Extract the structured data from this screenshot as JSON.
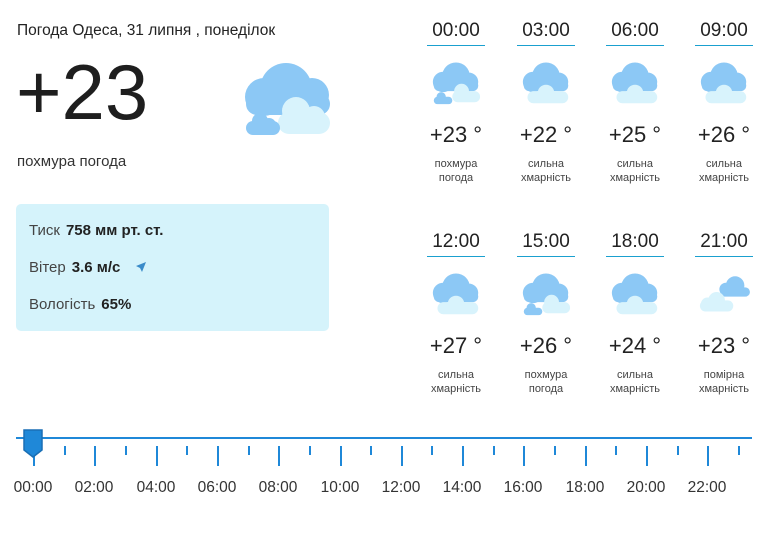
{
  "header": {
    "title": "Погода Одеса, 31 липня , понеділок",
    "temperature": "+23",
    "description": "похмура погода",
    "icon": "overcast-cloud-icon"
  },
  "details": {
    "pressure_label": "Тиск",
    "pressure_value": "758 мм рт. ст.",
    "wind_label": "Вітер",
    "wind_value": "3.6 м/с",
    "humidity_label": "Вологість",
    "humidity_value": "65%"
  },
  "hours": [
    {
      "time": "00:00",
      "temp": "+23 °",
      "desc1": "похмура",
      "desc2": "погода",
      "icon": "overcast-cloud-icon"
    },
    {
      "time": "03:00",
      "temp": "+22 °",
      "desc1": "сильна",
      "desc2": "хмарність",
      "icon": "cloudy-icon"
    },
    {
      "time": "06:00",
      "temp": "+25 °",
      "desc1": "сильна",
      "desc2": "хмарність",
      "icon": "cloudy-icon"
    },
    {
      "time": "09:00",
      "temp": "+26 °",
      "desc1": "сильна",
      "desc2": "хмарність",
      "icon": "cloudy-icon"
    },
    {
      "time": "12:00",
      "temp": "+27 °",
      "desc1": "сильна",
      "desc2": "хмарність",
      "icon": "cloudy-icon"
    },
    {
      "time": "15:00",
      "temp": "+26 °",
      "desc1": "похмура",
      "desc2": "погода",
      "icon": "overcast-cloud-icon"
    },
    {
      "time": "18:00",
      "temp": "+24 °",
      "desc1": "сильна",
      "desc2": "хмарність",
      "icon": "cloudy-icon"
    },
    {
      "time": "21:00",
      "temp": "+23 °",
      "desc1": "помірна",
      "desc2": "хмарність",
      "icon": "partly-cloudy-icon"
    }
  ],
  "timeline": {
    "labels": [
      "00:00",
      "02:00",
      "04:00",
      "06:00",
      "08:00",
      "10:00",
      "12:00",
      "14:00",
      "16:00",
      "18:00",
      "20:00",
      "22:00"
    ],
    "selected": "00:00"
  },
  "colors": {
    "accent": "#1f88d8",
    "panel_bg": "#d5f3fb",
    "cloud_dark": "#8cc8f5",
    "cloud_light": "#d8f3fc"
  }
}
